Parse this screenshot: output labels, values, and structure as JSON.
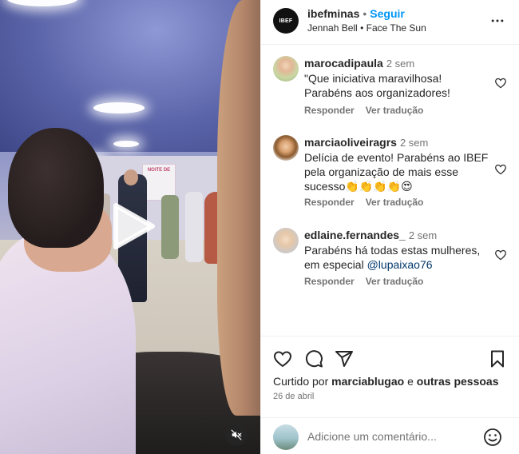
{
  "header": {
    "username": "ibefminas",
    "separator": "•",
    "follow_label": "Seguir",
    "avatar_text": "IBEF",
    "audio_artist": "Jennah Bell",
    "audio_separator": "•",
    "audio_track": "Face The Sun"
  },
  "video": {
    "banner_text": "NOITE DE"
  },
  "comments": [
    {
      "user": "marocadipaula",
      "time": "2 sem",
      "text": "\"Que iniciativa maravilhosa! Parabéns aos organizadores!",
      "reply_label": "Responder",
      "translate_label": "Ver tradução"
    },
    {
      "user": "marciaoliveiragrs",
      "time": "2 sem",
      "text": "Delícia de evento! Parabéns ao IBEF pela organização de mais esse sucesso👏👏👏👏😍",
      "reply_label": "Responder",
      "translate_label": "Ver tradução"
    },
    {
      "user": "edlaine.fernandes_",
      "time": "2 sem",
      "text_before": "Parabéns há todas estas mulheres, em especial ",
      "mention": "@lupaixao76",
      "reply_label": "Responder",
      "translate_label": "Ver tradução"
    }
  ],
  "likes": {
    "prefix": "Curtido por ",
    "user": "marciablugao",
    "middle": " e ",
    "others": "outras pessoas"
  },
  "date": "26 de abril",
  "add_comment": {
    "placeholder": "Adicione um comentário..."
  },
  "icons": {
    "more": "more-horizontal-icon",
    "heart": "heart-icon",
    "comment": "comment-icon",
    "share": "share-icon",
    "save": "bookmark-icon",
    "emoji": "emoji-icon",
    "play": "play-icon",
    "mute": "muted-speaker-icon"
  },
  "colors": {
    "follow": "#0095f6",
    "mention": "#00376b",
    "secondary_text": "#737373"
  }
}
